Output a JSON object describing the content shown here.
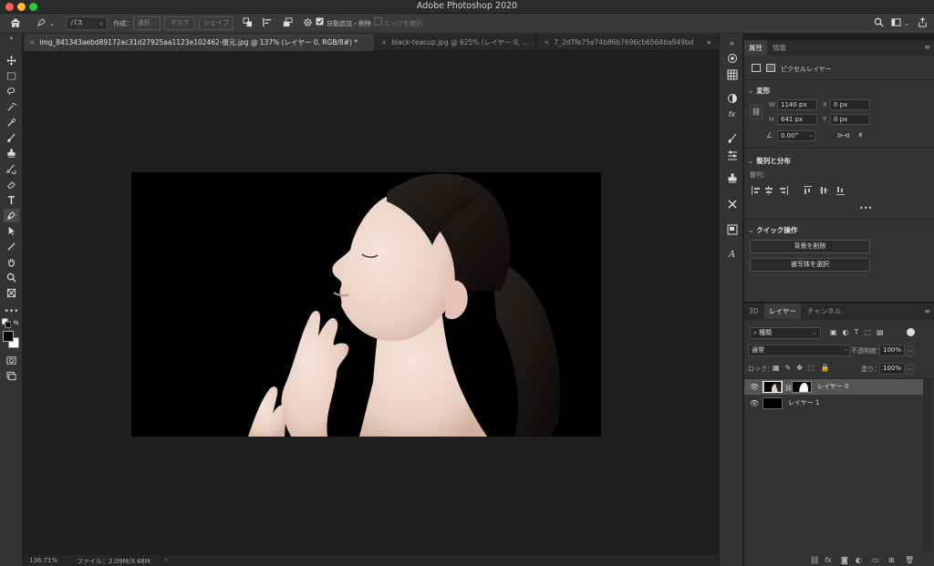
{
  "app": {
    "title": "Adobe Photoshop 2020"
  },
  "options_bar": {
    "path_mode": "パス",
    "make_label": "作成：",
    "select_btn": "選択...",
    "mask_btn": "マスク",
    "shape_btn": "シェイプ",
    "auto_add_delete": "自動追加・削除",
    "align_edges": "エッジを整列"
  },
  "tabs": [
    {
      "label": "img_841343aebd89172ac31d27925aa1123e102462-復元.jpg @ 137% (レイヤー 0, RGB/8#) *",
      "active": true
    },
    {
      "label": "black-teacup.jpg @ 625% (レイヤー 0, ...",
      "active": false
    },
    {
      "label": "7_2d7fe75e74b86b7696cb6564ba949bd",
      "active": false
    }
  ],
  "status": {
    "zoom": "136.71%",
    "file": "ファイル：2.09M/3.48M",
    "arrow": "›"
  },
  "properties": {
    "tabs": [
      "属性",
      "情報"
    ],
    "layer_type": "ピクセルレイヤー",
    "transform": {
      "heading": "変形",
      "w_label": "W",
      "w": "1140 px",
      "x_label": "X",
      "x": "0 px",
      "h_label": "H",
      "h": "641 px",
      "y_label": "Y",
      "y": "0 px",
      "angle": "0.00°"
    },
    "align": {
      "heading": "整列と分布",
      "sub": "整列：",
      "more": "•••"
    },
    "quick": {
      "heading": "クイック操作",
      "remove_bg": "背景を削除",
      "select_subject": "被写体を選択"
    }
  },
  "layers_panel": {
    "tabs": [
      "3D",
      "レイヤー",
      "チャンネル"
    ],
    "filter": "種類",
    "blend_mode": "通常",
    "opacity_label": "不透明度：",
    "opacity": "100%",
    "lock_label": "ロック：",
    "fill_label": "塗り：",
    "fill": "100%",
    "layers": [
      {
        "name": "レイヤー 0",
        "selected": true
      },
      {
        "name": "レイヤー 1",
        "selected": false
      }
    ],
    "footer_icons": [
      "link-icon",
      "fx-icon",
      "mask-icon",
      "adjustment-icon",
      "folder-icon",
      "new-layer-icon",
      "trash-icon"
    ],
    "fx_label": "fx"
  },
  "colors": {
    "bg": "#1d1d1d",
    "panel": "#333333",
    "accent": "#3a7bd5"
  }
}
